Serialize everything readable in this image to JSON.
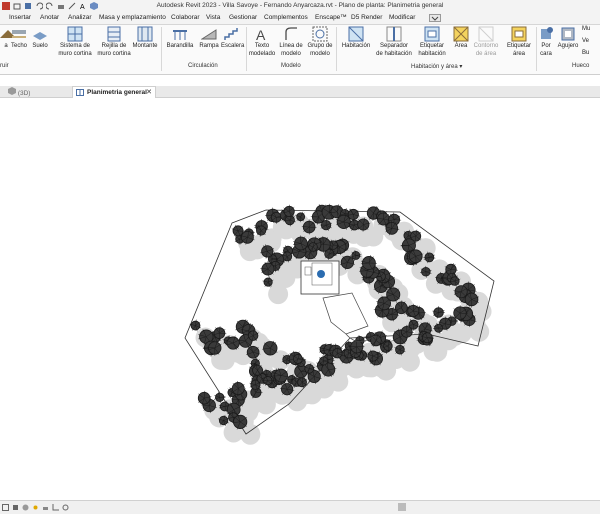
{
  "window": {
    "title": "Autodesk Revit 2023 - Villa Savoye - Fernando Anyarcaza.rvt - Plano de planta: Planimetria general"
  },
  "menu": {
    "items": [
      "Insertar",
      "Anotar",
      "Analizar",
      "Masa y emplazamiento",
      "Colaborar",
      "Vista",
      "Gestionar",
      "Complementos",
      "Enscape™",
      "D5 Render",
      "Modificar"
    ]
  },
  "ribbon": {
    "tools": {
      "cubierta": "a",
      "techo": "Techo",
      "suelo": "Suelo",
      "sistema_muro": [
        "Sistema de",
        "muro cortina"
      ],
      "rejilla": [
        "Rejilla de",
        "muro cortina"
      ],
      "montante": "Montante",
      "barandilla": "Barandilla",
      "rampa": "Rampa",
      "escalera": "Escalera",
      "texto_modelado": [
        "Texto",
        "modelado"
      ],
      "linea_modelo": [
        "Línea de",
        "modelo"
      ],
      "grupo_modelo": [
        "Grupo de",
        "modelo"
      ],
      "habitacion": "Habitación",
      "separador": [
        "Separador",
        "de habitación"
      ],
      "etiquetar_hab": [
        "Etiquetar",
        "habitación"
      ],
      "area": "Área",
      "contorno_area": [
        "Contorno",
        "de área"
      ],
      "etiquetar_area": [
        "Etiquetar",
        "área"
      ],
      "por_cara": [
        "Por",
        "cara"
      ],
      "agujero": "Agujero",
      "mu": "Mu",
      "ve": "Ve",
      "bu": "Bu"
    },
    "groups": {
      "construir": "ruir",
      "circulacion": "Circulación",
      "modelo": "Modelo",
      "habitacion_area": "Habitación y área ▾",
      "hueco": "Hueco"
    }
  },
  "view_tabs": {
    "inactive": "(3D)",
    "active": "Planimetria general",
    "close_glyph": "✕"
  },
  "colors": {
    "tree_dark": "#1a1a1a",
    "shadow": "#d9d9d9",
    "accent": "#2b6cb0"
  }
}
